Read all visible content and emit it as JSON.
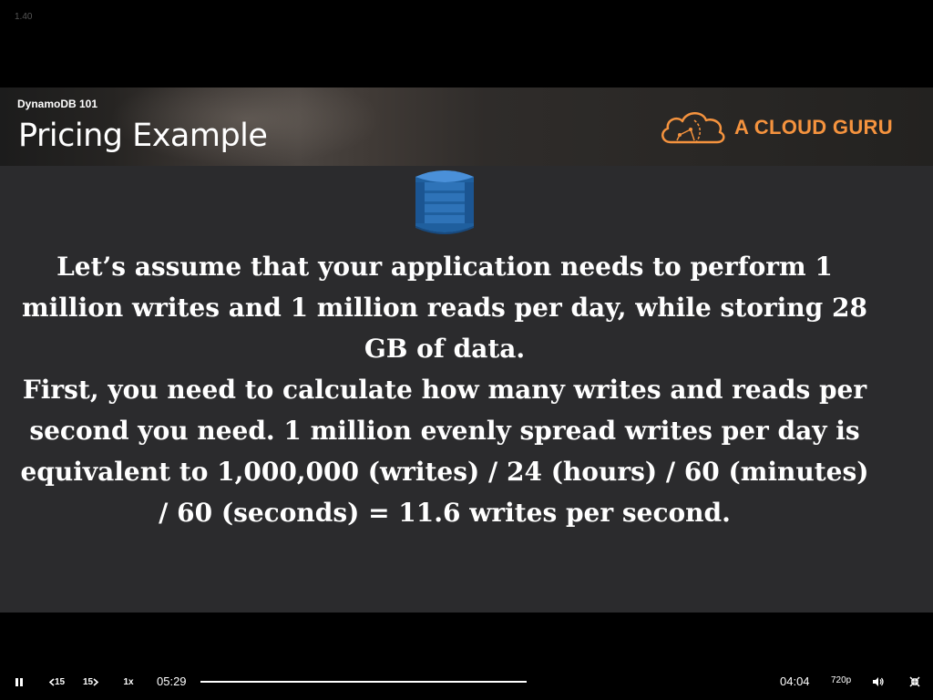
{
  "player": {
    "version": "1.40"
  },
  "slide": {
    "course": "DynamoDB 101",
    "title": "Pricing Example",
    "brand": "A CLOUD GURU",
    "db_icon": "dynamodb-icon",
    "paragraphs": [
      "Let’s assume that your application needs to perform 1 million writes and 1 million reads per day, while storing 28 GB of data.",
      "First, you need to calculate how many writes and reads per second you need. 1 million evenly spread writes per day is equivalent to 1,000,000 (writes) / 24 (hours) / 60 (minutes) / 60 (seconds) = 11.6 writes per second."
    ]
  },
  "controls": {
    "play_state_icon": "pause-icon",
    "rewind_label": "15",
    "forward_label": "15",
    "speed_label": "1x",
    "elapsed": "05:29",
    "remaining": "04:04",
    "quality": "720p",
    "volume_icon": "volume-icon",
    "fullscreen_icon": "exit-fullscreen-icon"
  },
  "colors": {
    "brand_orange": "#f5933e",
    "slide_background": "#2b2b2d",
    "dynamodb_blue": "#2e73b8"
  }
}
